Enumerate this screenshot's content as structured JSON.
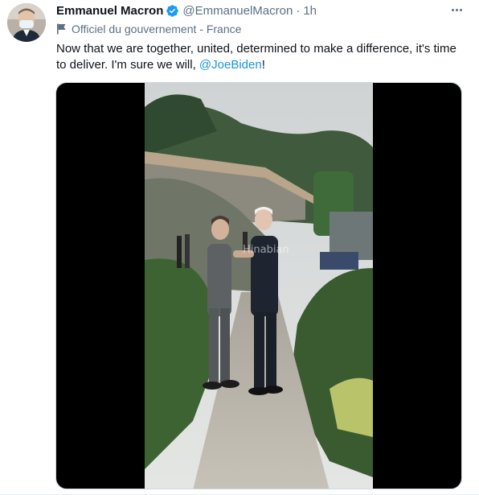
{
  "tweet": {
    "author_name": "Emmanuel Macron",
    "handle": "@EmmanuelMacron",
    "separator": "·",
    "time": "1h",
    "label": "Officiel du gouvernement - France",
    "text_before_mention": "Now that we are together, united, determined to make a difference, it's time to deliver. I'm sure we will, ",
    "mention": "@JoeBiden",
    "text_after_mention": "!"
  },
  "media": {
    "watermark": "Hinabian"
  },
  "icons": {
    "verified": "verified-badge-icon",
    "label": "government-flag-icon",
    "more": "more-horizontal-icon"
  },
  "colors": {
    "accent": "#1b95e0",
    "verified": "#1d9bf0",
    "secondary_text": "#5b7083",
    "primary_text": "#0f1419"
  }
}
